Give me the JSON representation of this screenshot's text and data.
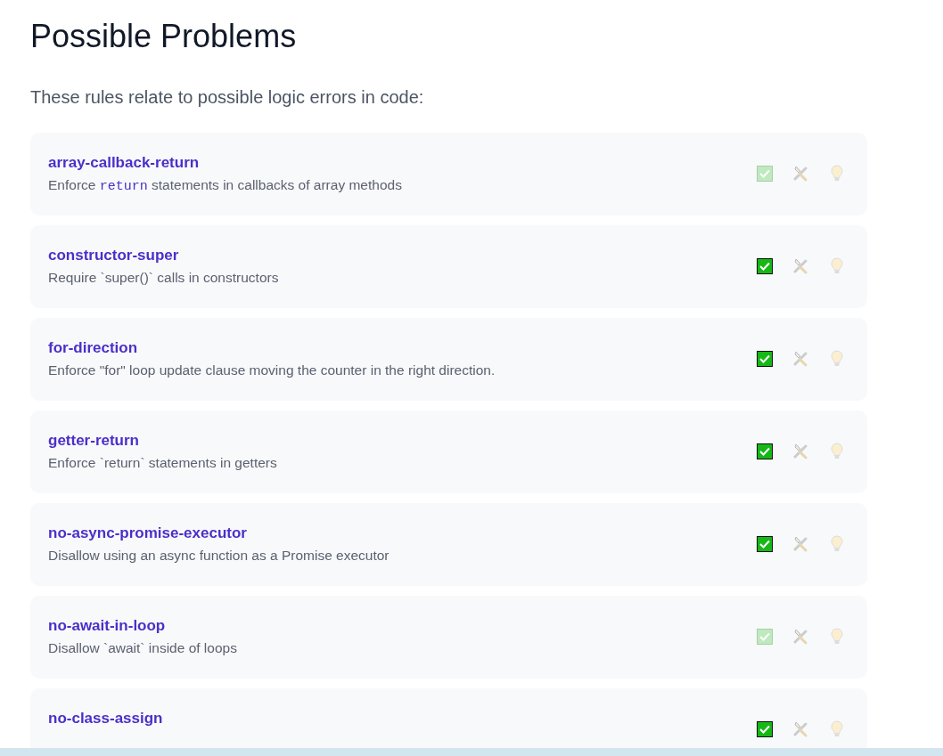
{
  "title": "Possible Problems",
  "intro": "These rules relate to possible logic errors in code:",
  "rules": [
    {
      "name": "array-callback-return",
      "disabled": true,
      "description": [
        {
          "kind": "text",
          "text": "Enforce "
        },
        {
          "kind": "code",
          "text": "return"
        },
        {
          "kind": "text",
          "text": " statements in callbacks of array methods"
        }
      ]
    },
    {
      "name": "constructor-super",
      "disabled": false,
      "description": [
        {
          "kind": "text",
          "text": "Require `super()` calls in constructors"
        }
      ]
    },
    {
      "name": "for-direction",
      "disabled": false,
      "description": [
        {
          "kind": "text",
          "text": "Enforce \"for\" loop update clause moving the counter in the right direction."
        }
      ]
    },
    {
      "name": "getter-return",
      "disabled": false,
      "description": [
        {
          "kind": "text",
          "text": "Enforce `return` statements in getters"
        }
      ]
    },
    {
      "name": "no-async-promise-executor",
      "disabled": false,
      "description": [
        {
          "kind": "text",
          "text": "Disallow using an async function as a Promise executor"
        }
      ]
    },
    {
      "name": "no-await-in-loop",
      "disabled": true,
      "description": [
        {
          "kind": "text",
          "text": "Disallow `await` inside of loops"
        }
      ]
    },
    {
      "name": "no-class-assign",
      "disabled": false
    }
  ]
}
